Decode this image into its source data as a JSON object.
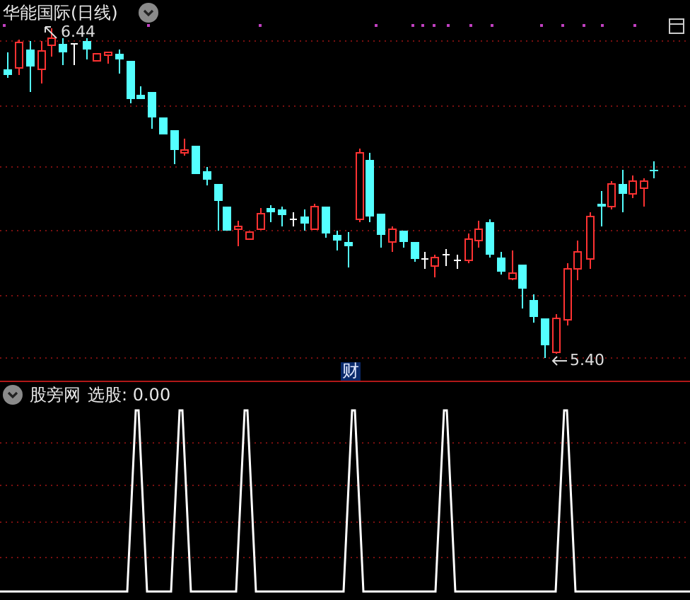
{
  "main_chart": {
    "title": "华能国际(日线)",
    "high_label": "6.44",
    "low_label": "5.40",
    "marker": "财"
  },
  "indicator_panel": {
    "name": "股旁网",
    "reading": "选股: 0.00"
  }
}
